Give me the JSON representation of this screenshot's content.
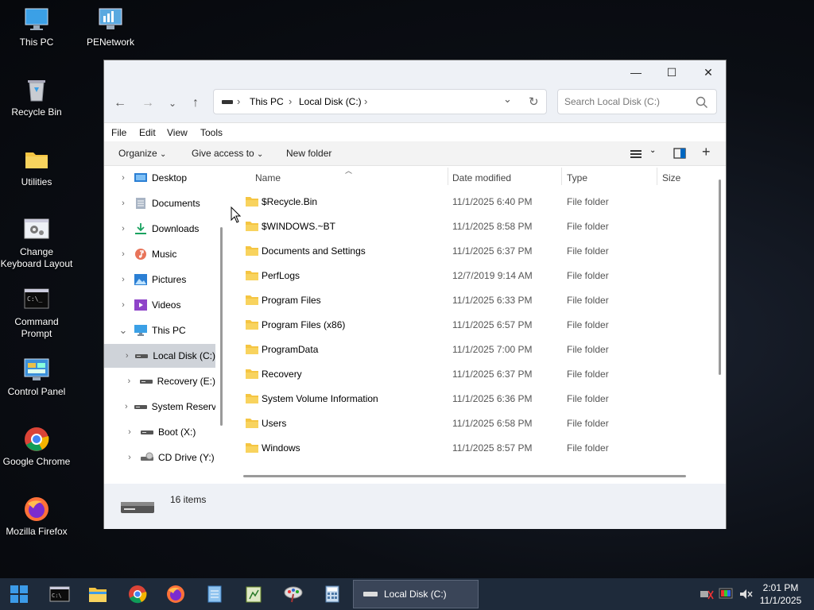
{
  "desktop": {
    "icons": [
      {
        "label": "This PC",
        "icon": "monitor-icon"
      },
      {
        "label": "PENetwork",
        "icon": "network-icon"
      },
      {
        "label": "Recycle Bin",
        "icon": "recycle-bin-icon"
      },
      {
        "label": "Utilities",
        "icon": "folder-icon"
      },
      {
        "label": "Change Keyboard Layout",
        "icon": "settings-window-icon"
      },
      {
        "label": "Command Prompt",
        "icon": "terminal-icon"
      },
      {
        "label": "Control Panel",
        "icon": "control-panel-icon"
      },
      {
        "label": "Google Chrome",
        "icon": "chrome-icon"
      },
      {
        "label": "Mozilla Firefox",
        "icon": "firefox-icon"
      }
    ]
  },
  "window": {
    "controls": {
      "minimize": "—",
      "maximize": "☐",
      "close": "✕"
    },
    "nav": {
      "back": "←",
      "forward": "→",
      "recent": "⌄",
      "up": "↑",
      "refresh": "↻",
      "history": "⌄"
    },
    "breadcrumb": [
      "This PC",
      "Local Disk (C:)"
    ],
    "breadcrumb_sep": "›",
    "search_placeholder": "Search Local Disk (C:)",
    "menu": [
      "File",
      "Edit",
      "View",
      "Tools"
    ],
    "commands": {
      "organize": "Organize",
      "give_access": "Give access to",
      "new_folder": "New folder",
      "caret": "⌄"
    },
    "nav_pane": [
      {
        "label": "Desktop",
        "icon": "desktop-icon",
        "level": 0,
        "expanded": false,
        "selected": false
      },
      {
        "label": "Documents",
        "icon": "documents-icon",
        "level": 0,
        "expanded": false,
        "selected": false
      },
      {
        "label": "Downloads",
        "icon": "download-icon",
        "level": 0,
        "expanded": false,
        "selected": false
      },
      {
        "label": "Music",
        "icon": "music-icon",
        "level": 0,
        "expanded": false,
        "selected": false
      },
      {
        "label": "Pictures",
        "icon": "pictures-icon",
        "level": 0,
        "expanded": false,
        "selected": false
      },
      {
        "label": "Videos",
        "icon": "videos-icon",
        "level": 0,
        "expanded": false,
        "selected": false
      },
      {
        "label": "This PC",
        "icon": "monitor-icon",
        "level": 0,
        "expanded": true,
        "selected": false
      },
      {
        "label": "Local Disk (C:)",
        "icon": "drive-icon",
        "level": 1,
        "expanded": false,
        "selected": true
      },
      {
        "label": "Recovery (E:)",
        "icon": "drive-icon",
        "level": 1,
        "expanded": false,
        "selected": false
      },
      {
        "label": "System Reserved",
        "icon": "drive-icon",
        "level": 1,
        "expanded": false,
        "selected": false
      },
      {
        "label": "Boot (X:)",
        "icon": "drive-icon",
        "level": 1,
        "expanded": false,
        "selected": false
      },
      {
        "label": "CD Drive (Y:)",
        "icon": "cd-drive-icon",
        "level": 1,
        "expanded": false,
        "selected": false
      }
    ],
    "columns": [
      "Name",
      "Date modified",
      "Type",
      "Size"
    ],
    "files": [
      {
        "name": "$Recycle.Bin",
        "date": "11/1/2025 6:40 PM",
        "type": "File folder",
        "size": ""
      },
      {
        "name": "$WINDOWS.~BT",
        "date": "11/1/2025 8:58 PM",
        "type": "File folder",
        "size": ""
      },
      {
        "name": "Documents and Settings",
        "date": "11/1/2025 6:37 PM",
        "type": "File folder",
        "size": ""
      },
      {
        "name": "PerfLogs",
        "date": "12/7/2019 9:14 AM",
        "type": "File folder",
        "size": ""
      },
      {
        "name": "Program Files",
        "date": "11/1/2025 6:33 PM",
        "type": "File folder",
        "size": ""
      },
      {
        "name": "Program Files (x86)",
        "date": "11/1/2025 6:57 PM",
        "type": "File folder",
        "size": ""
      },
      {
        "name": "ProgramData",
        "date": "11/1/2025 7:00 PM",
        "type": "File folder",
        "size": ""
      },
      {
        "name": "Recovery",
        "date": "11/1/2025 6:37 PM",
        "type": "File folder",
        "size": ""
      },
      {
        "name": "System Volume Information",
        "date": "11/1/2025 6:36 PM",
        "type": "File folder",
        "size": ""
      },
      {
        "name": "Users",
        "date": "11/1/2025 6:58 PM",
        "type": "File folder",
        "size": ""
      },
      {
        "name": "Windows",
        "date": "11/1/2025 8:57 PM",
        "type": "File folder",
        "size": ""
      }
    ],
    "status": {
      "item_count": "16 items"
    }
  },
  "taskbar": {
    "apps": [
      "start-icon",
      "terminal-icon",
      "file-explorer-icon",
      "chrome-icon",
      "firefox-icon",
      "notepad-icon",
      "editor-icon",
      "paint-icon",
      "calculator-icon"
    ],
    "active_window": "Local Disk (C:)",
    "time": "2:01 PM",
    "date": "11/1/2025"
  },
  "colors": {
    "folder": "#f5c542",
    "accent": "#0067c0",
    "taskbar": "#1e2a3a"
  }
}
